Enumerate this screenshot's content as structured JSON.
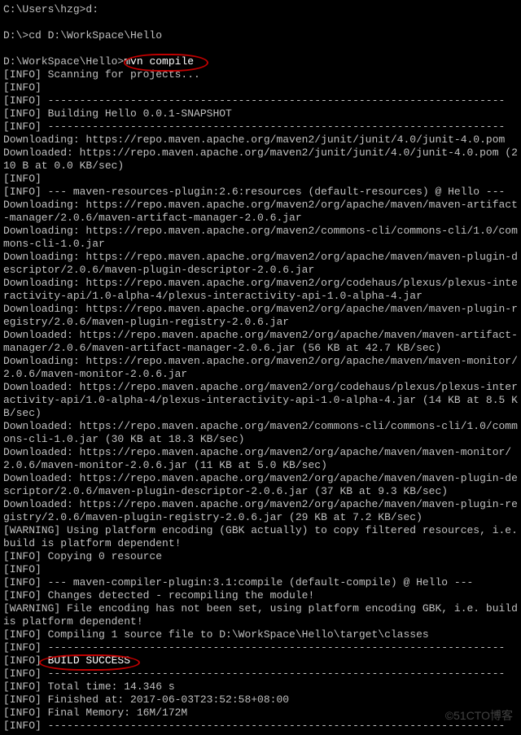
{
  "prompt1": "C:\\Users\\hzg>d:",
  "blank": "",
  "prompt2": "D:\\>cd D:\\WorkSpace\\Hello",
  "prompt3_prefix": "D:\\WorkSpace\\Hello>",
  "command": "mvn compile",
  "lines": [
    "[INFO] Scanning for projects...",
    "[INFO]",
    "[INFO] ------------------------------------------------------------------------",
    "[INFO] Building Hello 0.0.1-SNAPSHOT",
    "[INFO] ------------------------------------------------------------------------",
    "Downloading: https://repo.maven.apache.org/maven2/junit/junit/4.0/junit-4.0.pom",
    "Downloaded: https://repo.maven.apache.org/maven2/junit/junit/4.0/junit-4.0.pom (210 B at 0.0 KB/sec)",
    "[INFO]",
    "[INFO] --- maven-resources-plugin:2.6:resources (default-resources) @ Hello ---",
    "Downloading: https://repo.maven.apache.org/maven2/org/apache/maven/maven-artifact-manager/2.0.6/maven-artifact-manager-2.0.6.jar",
    "Downloading: https://repo.maven.apache.org/maven2/commons-cli/commons-cli/1.0/commons-cli-1.0.jar",
    "Downloading: https://repo.maven.apache.org/maven2/org/apache/maven/maven-plugin-descriptor/2.0.6/maven-plugin-descriptor-2.0.6.jar",
    "Downloading: https://repo.maven.apache.org/maven2/org/codehaus/plexus/plexus-interactivity-api/1.0-alpha-4/plexus-interactivity-api-1.0-alpha-4.jar",
    "Downloading: https://repo.maven.apache.org/maven2/org/apache/maven/maven-plugin-registry/2.0.6/maven-plugin-registry-2.0.6.jar",
    "Downloaded: https://repo.maven.apache.org/maven2/org/apache/maven/maven-artifact-manager/2.0.6/maven-artifact-manager-2.0.6.jar (56 KB at 42.7 KB/sec)",
    "Downloading: https://repo.maven.apache.org/maven2/org/apache/maven/maven-monitor/2.0.6/maven-monitor-2.0.6.jar",
    "Downloaded: https://repo.maven.apache.org/maven2/org/codehaus/plexus/plexus-interactivity-api/1.0-alpha-4/plexus-interactivity-api-1.0-alpha-4.jar (14 KB at 8.5 KB/sec)",
    "Downloaded: https://repo.maven.apache.org/maven2/commons-cli/commons-cli/1.0/commons-cli-1.0.jar (30 KB at 18.3 KB/sec)",
    "Downloaded: https://repo.maven.apache.org/maven2/org/apache/maven/maven-monitor/2.0.6/maven-monitor-2.0.6.jar (11 KB at 5.0 KB/sec)",
    "Downloaded: https://repo.maven.apache.org/maven2/org/apache/maven/maven-plugin-descriptor/2.0.6/maven-plugin-descriptor-2.0.6.jar (37 KB at 9.3 KB/sec)",
    "Downloaded: https://repo.maven.apache.org/maven2/org/apache/maven/maven-plugin-registry/2.0.6/maven-plugin-registry-2.0.6.jar (29 KB at 7.2 KB/sec)",
    "[WARNING] Using platform encoding (GBK actually) to copy filtered resources, i.e. build is platform dependent!",
    "[INFO] Copying 0 resource",
    "[INFO]",
    "[INFO] --- maven-compiler-plugin:3.1:compile (default-compile) @ Hello ---",
    "[INFO] Changes detected - recompiling the module!",
    "[WARNING] File encoding has not been set, using platform encoding GBK, i.e. build is platform dependent!",
    "[INFO] Compiling 1 source file to D:\\WorkSpace\\Hello\\target\\classes",
    "[INFO] ------------------------------------------------------------------------"
  ],
  "success_prefix": "[INFO] ",
  "success_label": "BUILD SUCCESS",
  "trailer": [
    "[INFO] ------------------------------------------------------------------------",
    "[INFO] Total time: 14.346 s",
    "[INFO] Finished at: 2017-06-03T23:52:58+08:00",
    "[INFO] Final Memory: 16M/172M",
    "[INFO] ------------------------------------------------------------------------"
  ],
  "watermark": "©51CTO博客"
}
